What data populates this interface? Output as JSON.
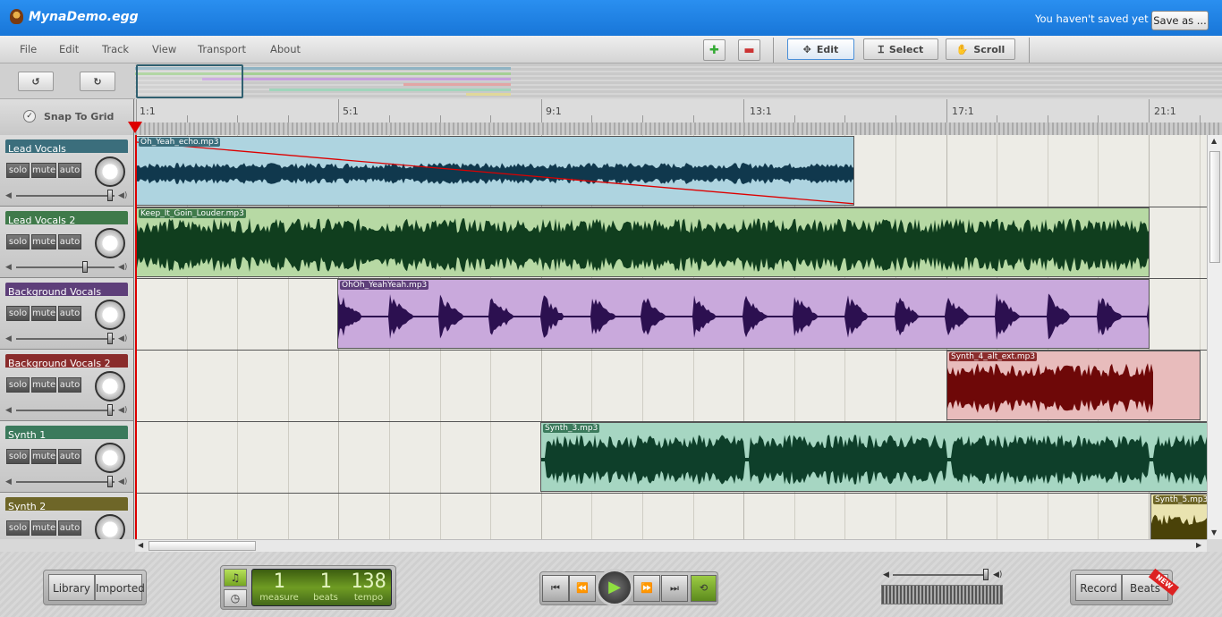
{
  "window": {
    "title": "MynaDemo.egg",
    "save_status": "You haven't saved yet",
    "save_as": "Save as ..."
  },
  "menu": [
    "File",
    "Edit",
    "Track",
    "View",
    "Transport",
    "About"
  ],
  "toolbar": {
    "edit": "Edit",
    "select": "Select",
    "scroll": "Scroll"
  },
  "snap_label": "Snap To Grid",
  "ruler": [
    "1:1",
    "5:1",
    "9:1",
    "13:1",
    "17:1",
    "21:1"
  ],
  "tracks": [
    {
      "name": "Lead Vocals",
      "color": "#3b6e7c",
      "clip": "Oh_Yeah_echo.mp3"
    },
    {
      "name": "Lead Vocals 2",
      "color": "#3f7a4a",
      "clip": "Keep_It_Goin_Louder.mp3"
    },
    {
      "name": "Background Vocals",
      "color": "#5e3f7a",
      "clip": "OhOh_YeahYeah.mp3"
    },
    {
      "name": "Background Vocals 2",
      "color": "#8a2c2c",
      "clip": "Synth_4_alt_ext.mp3"
    },
    {
      "name": "Synth 1",
      "color": "#3b7a5c",
      "clip": "Synth_3.mp3"
    },
    {
      "name": "Synth 2",
      "color": "#6e6628",
      "clip": "Synth_5.mp3"
    }
  ],
  "track_buttons": {
    "solo": "solo",
    "mute": "mute",
    "auto": "auto"
  },
  "footer": {
    "library": "Library",
    "imported": "Imported",
    "measure": "1",
    "measure_label": "measure",
    "beats": "1",
    "beats_label": "beats",
    "tempo": "138",
    "tempo_label": "tempo",
    "record": "Record",
    "beats_btn": "Beats",
    "new_badge": "NEW"
  }
}
